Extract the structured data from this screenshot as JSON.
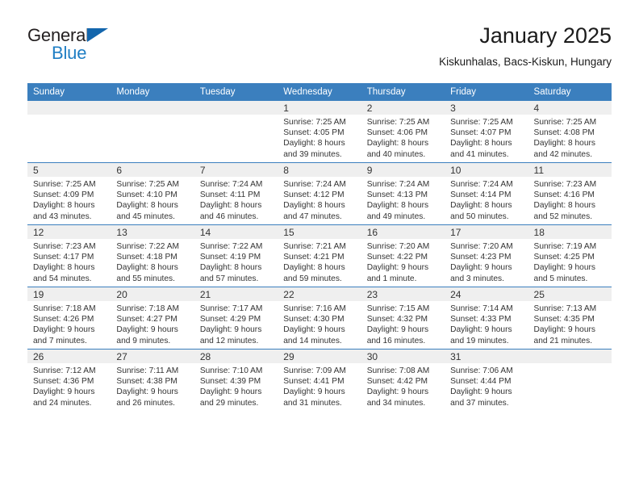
{
  "brand": {
    "name_part1": "General",
    "name_part2": "Blue",
    "logo_icon": "triangle-icon",
    "color_dark": "#231f20",
    "color_blue": "#1f7ec4"
  },
  "header": {
    "title": "January 2025",
    "subtitle": "Kiskunhalas, Bacs-Kiskun, Hungary"
  },
  "theme": {
    "header_blue": "#3b7fbe",
    "daynum_band": "#efefef",
    "text": "#333333"
  },
  "calendar": {
    "weekday_headers": [
      "Sunday",
      "Monday",
      "Tuesday",
      "Wednesday",
      "Thursday",
      "Friday",
      "Saturday"
    ],
    "weeks": [
      [
        {
          "day": "",
          "empty": true
        },
        {
          "day": "",
          "empty": true
        },
        {
          "day": "",
          "empty": true
        },
        {
          "day": "1",
          "sunrise": "Sunrise: 7:25 AM",
          "sunset": "Sunset: 4:05 PM",
          "daylight_line1": "Daylight: 8 hours",
          "daylight_line2": "and 39 minutes."
        },
        {
          "day": "2",
          "sunrise": "Sunrise: 7:25 AM",
          "sunset": "Sunset: 4:06 PM",
          "daylight_line1": "Daylight: 8 hours",
          "daylight_line2": "and 40 minutes."
        },
        {
          "day": "3",
          "sunrise": "Sunrise: 7:25 AM",
          "sunset": "Sunset: 4:07 PM",
          "daylight_line1": "Daylight: 8 hours",
          "daylight_line2": "and 41 minutes."
        },
        {
          "day": "4",
          "sunrise": "Sunrise: 7:25 AM",
          "sunset": "Sunset: 4:08 PM",
          "daylight_line1": "Daylight: 8 hours",
          "daylight_line2": "and 42 minutes."
        }
      ],
      [
        {
          "day": "5",
          "sunrise": "Sunrise: 7:25 AM",
          "sunset": "Sunset: 4:09 PM",
          "daylight_line1": "Daylight: 8 hours",
          "daylight_line2": "and 43 minutes."
        },
        {
          "day": "6",
          "sunrise": "Sunrise: 7:25 AM",
          "sunset": "Sunset: 4:10 PM",
          "daylight_line1": "Daylight: 8 hours",
          "daylight_line2": "and 45 minutes."
        },
        {
          "day": "7",
          "sunrise": "Sunrise: 7:24 AM",
          "sunset": "Sunset: 4:11 PM",
          "daylight_line1": "Daylight: 8 hours",
          "daylight_line2": "and 46 minutes."
        },
        {
          "day": "8",
          "sunrise": "Sunrise: 7:24 AM",
          "sunset": "Sunset: 4:12 PM",
          "daylight_line1": "Daylight: 8 hours",
          "daylight_line2": "and 47 minutes."
        },
        {
          "day": "9",
          "sunrise": "Sunrise: 7:24 AM",
          "sunset": "Sunset: 4:13 PM",
          "daylight_line1": "Daylight: 8 hours",
          "daylight_line2": "and 49 minutes."
        },
        {
          "day": "10",
          "sunrise": "Sunrise: 7:24 AM",
          "sunset": "Sunset: 4:14 PM",
          "daylight_line1": "Daylight: 8 hours",
          "daylight_line2": "and 50 minutes."
        },
        {
          "day": "11",
          "sunrise": "Sunrise: 7:23 AM",
          "sunset": "Sunset: 4:16 PM",
          "daylight_line1": "Daylight: 8 hours",
          "daylight_line2": "and 52 minutes."
        }
      ],
      [
        {
          "day": "12",
          "sunrise": "Sunrise: 7:23 AM",
          "sunset": "Sunset: 4:17 PM",
          "daylight_line1": "Daylight: 8 hours",
          "daylight_line2": "and 54 minutes."
        },
        {
          "day": "13",
          "sunrise": "Sunrise: 7:22 AM",
          "sunset": "Sunset: 4:18 PM",
          "daylight_line1": "Daylight: 8 hours",
          "daylight_line2": "and 55 minutes."
        },
        {
          "day": "14",
          "sunrise": "Sunrise: 7:22 AM",
          "sunset": "Sunset: 4:19 PM",
          "daylight_line1": "Daylight: 8 hours",
          "daylight_line2": "and 57 minutes."
        },
        {
          "day": "15",
          "sunrise": "Sunrise: 7:21 AM",
          "sunset": "Sunset: 4:21 PM",
          "daylight_line1": "Daylight: 8 hours",
          "daylight_line2": "and 59 minutes."
        },
        {
          "day": "16",
          "sunrise": "Sunrise: 7:20 AM",
          "sunset": "Sunset: 4:22 PM",
          "daylight_line1": "Daylight: 9 hours",
          "daylight_line2": "and 1 minute."
        },
        {
          "day": "17",
          "sunrise": "Sunrise: 7:20 AM",
          "sunset": "Sunset: 4:23 PM",
          "daylight_line1": "Daylight: 9 hours",
          "daylight_line2": "and 3 minutes."
        },
        {
          "day": "18",
          "sunrise": "Sunrise: 7:19 AM",
          "sunset": "Sunset: 4:25 PM",
          "daylight_line1": "Daylight: 9 hours",
          "daylight_line2": "and 5 minutes."
        }
      ],
      [
        {
          "day": "19",
          "sunrise": "Sunrise: 7:18 AM",
          "sunset": "Sunset: 4:26 PM",
          "daylight_line1": "Daylight: 9 hours",
          "daylight_line2": "and 7 minutes."
        },
        {
          "day": "20",
          "sunrise": "Sunrise: 7:18 AM",
          "sunset": "Sunset: 4:27 PM",
          "daylight_line1": "Daylight: 9 hours",
          "daylight_line2": "and 9 minutes."
        },
        {
          "day": "21",
          "sunrise": "Sunrise: 7:17 AM",
          "sunset": "Sunset: 4:29 PM",
          "daylight_line1": "Daylight: 9 hours",
          "daylight_line2": "and 12 minutes."
        },
        {
          "day": "22",
          "sunrise": "Sunrise: 7:16 AM",
          "sunset": "Sunset: 4:30 PM",
          "daylight_line1": "Daylight: 9 hours",
          "daylight_line2": "and 14 minutes."
        },
        {
          "day": "23",
          "sunrise": "Sunrise: 7:15 AM",
          "sunset": "Sunset: 4:32 PM",
          "daylight_line1": "Daylight: 9 hours",
          "daylight_line2": "and 16 minutes."
        },
        {
          "day": "24",
          "sunrise": "Sunrise: 7:14 AM",
          "sunset": "Sunset: 4:33 PM",
          "daylight_line1": "Daylight: 9 hours",
          "daylight_line2": "and 19 minutes."
        },
        {
          "day": "25",
          "sunrise": "Sunrise: 7:13 AM",
          "sunset": "Sunset: 4:35 PM",
          "daylight_line1": "Daylight: 9 hours",
          "daylight_line2": "and 21 minutes."
        }
      ],
      [
        {
          "day": "26",
          "sunrise": "Sunrise: 7:12 AM",
          "sunset": "Sunset: 4:36 PM",
          "daylight_line1": "Daylight: 9 hours",
          "daylight_line2": "and 24 minutes."
        },
        {
          "day": "27",
          "sunrise": "Sunrise: 7:11 AM",
          "sunset": "Sunset: 4:38 PM",
          "daylight_line1": "Daylight: 9 hours",
          "daylight_line2": "and 26 minutes."
        },
        {
          "day": "28",
          "sunrise": "Sunrise: 7:10 AM",
          "sunset": "Sunset: 4:39 PM",
          "daylight_line1": "Daylight: 9 hours",
          "daylight_line2": "and 29 minutes."
        },
        {
          "day": "29",
          "sunrise": "Sunrise: 7:09 AM",
          "sunset": "Sunset: 4:41 PM",
          "daylight_line1": "Daylight: 9 hours",
          "daylight_line2": "and 31 minutes."
        },
        {
          "day": "30",
          "sunrise": "Sunrise: 7:08 AM",
          "sunset": "Sunset: 4:42 PM",
          "daylight_line1": "Daylight: 9 hours",
          "daylight_line2": "and 34 minutes."
        },
        {
          "day": "31",
          "sunrise": "Sunrise: 7:06 AM",
          "sunset": "Sunset: 4:44 PM",
          "daylight_line1": "Daylight: 9 hours",
          "daylight_line2": "and 37 minutes."
        },
        {
          "day": "",
          "empty": true
        }
      ]
    ]
  }
}
